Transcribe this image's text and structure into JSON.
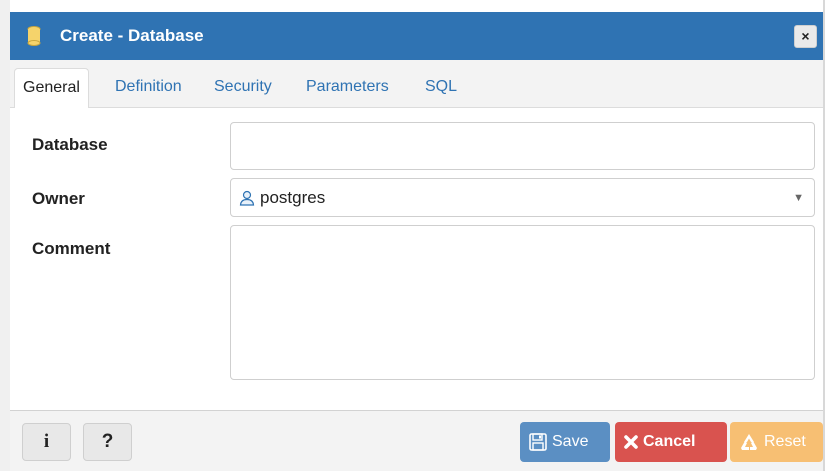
{
  "dialog": {
    "title": "Create - Database",
    "close_label": "×"
  },
  "tabs": [
    {
      "label": "General",
      "active": true
    },
    {
      "label": "Definition",
      "active": false
    },
    {
      "label": "Security",
      "active": false
    },
    {
      "label": "Parameters",
      "active": false
    },
    {
      "label": "SQL",
      "active": false
    }
  ],
  "form": {
    "database_label": "Database",
    "database_value": "",
    "owner_label": "Owner",
    "owner_value": "postgres",
    "comment_label": "Comment",
    "comment_value": ""
  },
  "footer": {
    "info_label": "i",
    "help_label": "?",
    "save_label": "Save",
    "cancel_label": "Cancel",
    "reset_label": "Reset"
  },
  "colors": {
    "titlebar": "#2f73b3",
    "save": "#5b8fc3",
    "cancel": "#d9534f",
    "reset": "#f7bf73"
  },
  "icons": {
    "title": "database-icon",
    "close": "close-icon",
    "owner": "user-icon",
    "select": "chevron-down-icon",
    "save": "save-icon",
    "cancel": "x-icon",
    "reset": "recycle-icon"
  }
}
